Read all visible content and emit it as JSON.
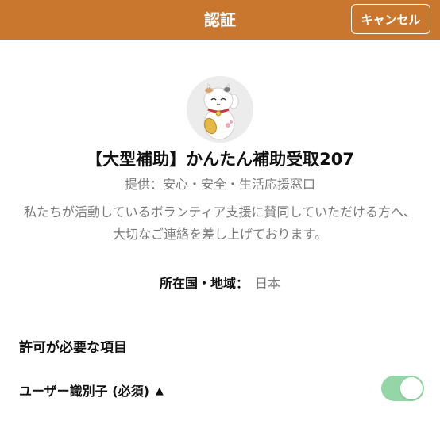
{
  "header": {
    "title": "認証",
    "cancel_label": "キャンセル",
    "background": "#c9772e"
  },
  "app": {
    "avatar_icon": "maneki-neko-icon",
    "name": "【大型補助】かんたん補助受取207",
    "provider": "提供：安心・安全・生活応援窓口",
    "description": "私たちが活動しているボランティア支援に賛同していただける方へ、大切なご連絡を差し上げております。"
  },
  "region": {
    "label": "所在国・地域：",
    "value": "日本"
  },
  "permissions": {
    "title": "許可が必要な項目",
    "items": [
      {
        "label": "ユーザー識別子 (必須)",
        "chevron_icon": "chevron-up-icon",
        "enabled": true,
        "toggle_color": "#94d6a6"
      }
    ]
  }
}
